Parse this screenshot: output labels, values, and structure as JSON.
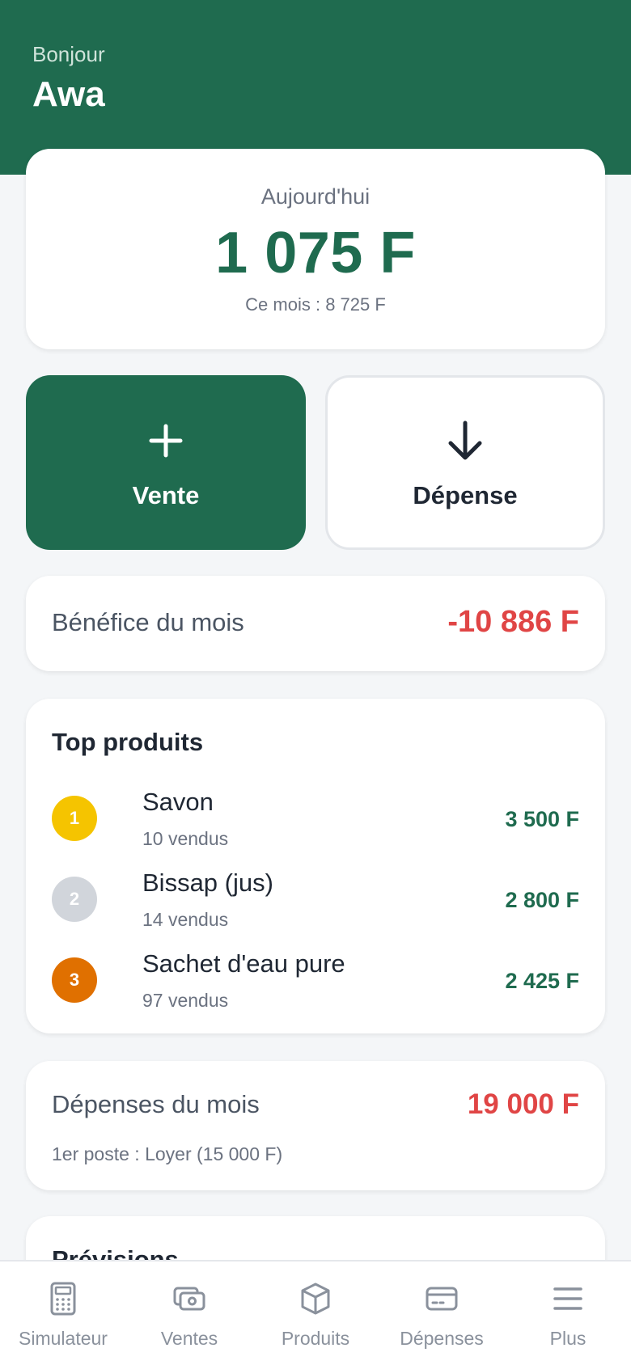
{
  "header": {
    "greeting": "Bonjour",
    "name": "Awa"
  },
  "today": {
    "label": "Aujourd'hui",
    "amount": "1 075 F",
    "month": "Ce mois : 8 725 F"
  },
  "actions": {
    "sale": "Vente",
    "expense": "Dépense"
  },
  "profit": {
    "label": "Bénéfice du mois",
    "value": "-10 886 F"
  },
  "top_products": {
    "title": "Top produits",
    "items": [
      {
        "rank": "1",
        "name": "Savon",
        "sold": "10 vendus",
        "amount": "3 500 F",
        "rank_color": "#f5c400"
      },
      {
        "rank": "2",
        "name": "Bissap (jus)",
        "sold": "14 vendus",
        "amount": "2 800 F",
        "rank_color": "#d1d5db"
      },
      {
        "rank": "3",
        "name": "Sachet d'eau pure",
        "sold": "97 vendus",
        "amount": "2 425 F",
        "rank_color": "#e07000"
      }
    ]
  },
  "expenses": {
    "label": "Dépenses du mois",
    "value": "19 000 F",
    "sub": "1er poste : Loyer (15 000 F)"
  },
  "forecast": {
    "title": "Prévisions"
  },
  "nav": [
    {
      "label": "Simulateur",
      "icon": "calculator-icon"
    },
    {
      "label": "Ventes",
      "icon": "cash-icon"
    },
    {
      "label": "Produits",
      "icon": "box-icon"
    },
    {
      "label": "Dépenses",
      "icon": "card-icon"
    },
    {
      "label": "Plus",
      "icon": "menu-icon"
    }
  ],
  "colors": {
    "brand": "#1f6b4f",
    "negative": "#e04545",
    "muted": "#6b7280"
  }
}
